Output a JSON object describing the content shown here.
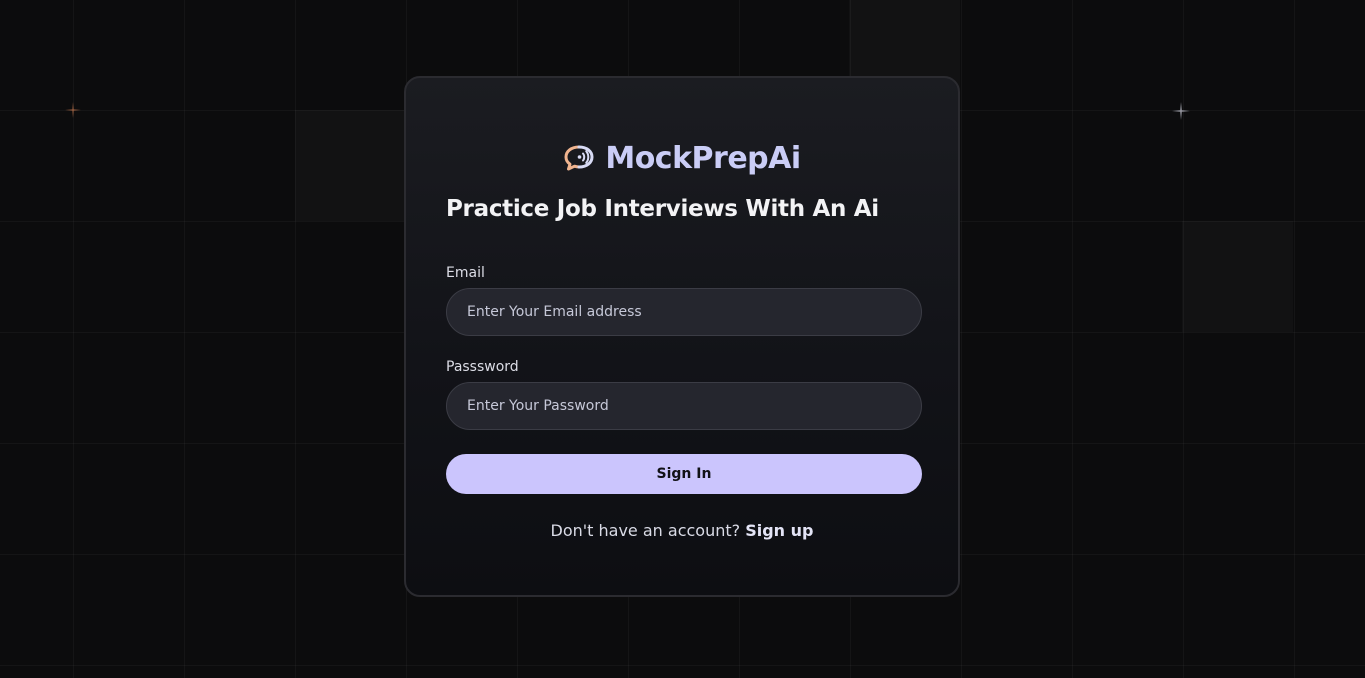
{
  "brand": {
    "name": "MockPrepAi",
    "logo_icon": "chat-bubble-sound-icon",
    "color": "#cacdf6"
  },
  "headline": "Practice Job Interviews With An Ai",
  "form": {
    "email": {
      "label": "Email",
      "placeholder": "Enter Your Email address",
      "value": ""
    },
    "password": {
      "label": "Passsword",
      "placeholder": "Enter Your Password",
      "value": ""
    },
    "submit_label": "Sign In"
  },
  "footer": {
    "prompt": "Don't have an account?",
    "link_label": "Sign up"
  },
  "colors": {
    "background": "#0c0c0d",
    "card": "#15161b",
    "accent": "#cbc5fd",
    "input_bg": "#25262e"
  }
}
